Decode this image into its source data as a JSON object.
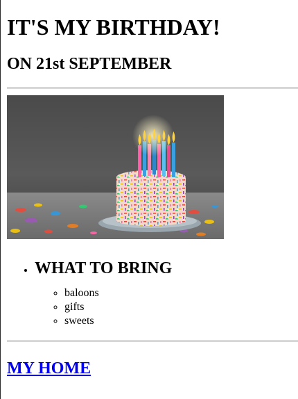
{
  "header": {
    "title": "IT'S MY BIRTHDAY!",
    "subtitle": "ON 21st SEPTEMBER"
  },
  "hero": {
    "subject": "birthday cake with lit candles and confetti"
  },
  "bring": {
    "heading": "WHAT TO BRING",
    "items": [
      "baloons",
      "gifts",
      "sweets"
    ]
  },
  "footer": {
    "link_label": "MY HOME"
  },
  "colors": {
    "link": "#0000ee",
    "rule": "#8c8c8c"
  }
}
